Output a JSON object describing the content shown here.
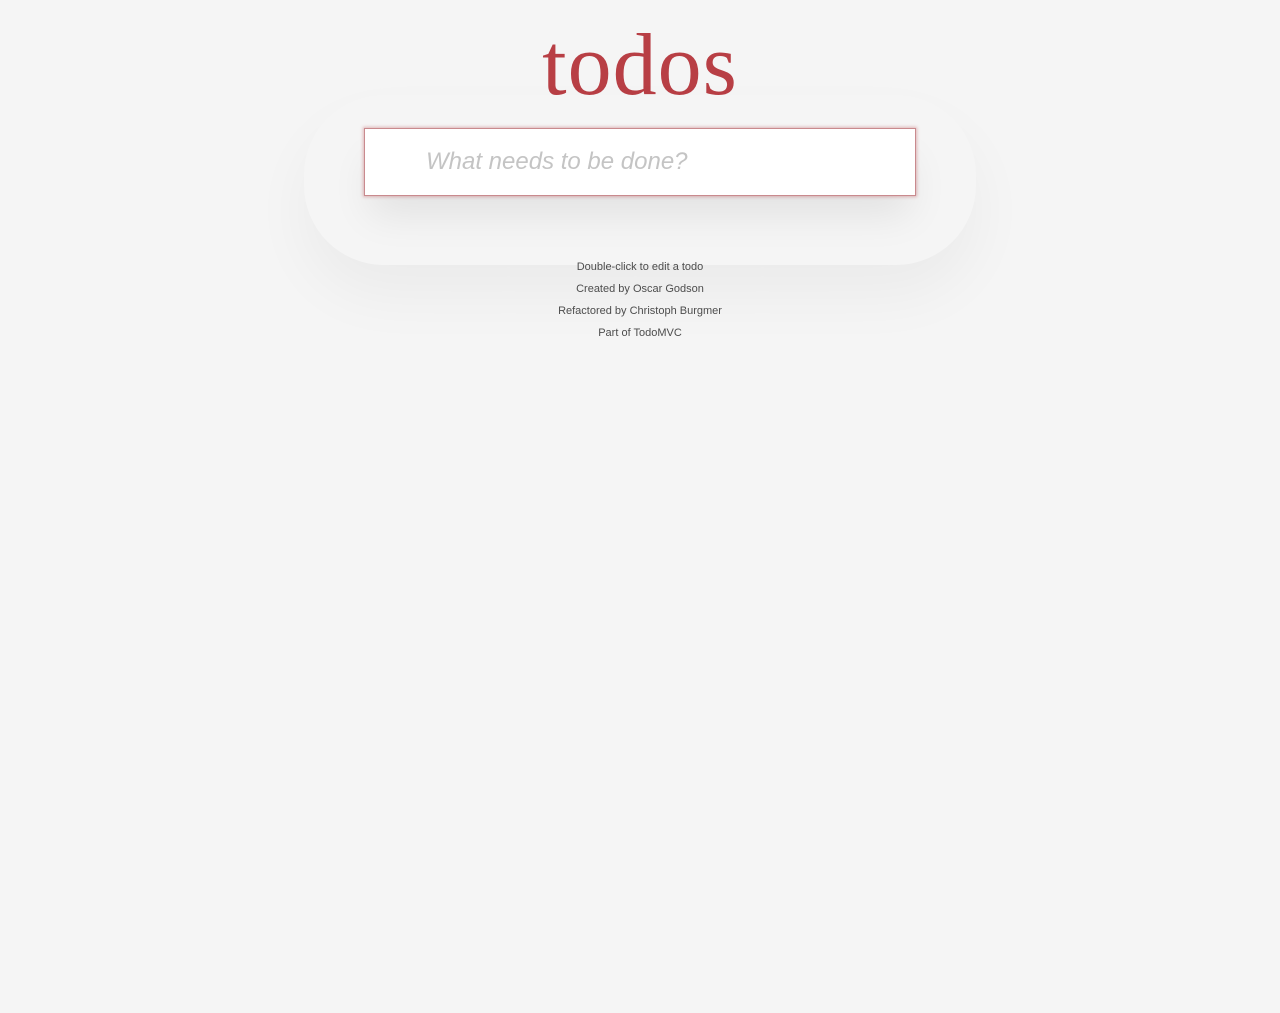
{
  "app": {
    "title": "todos"
  },
  "new_todo": {
    "value": "",
    "placeholder": "What needs to be done?"
  },
  "info": {
    "edit_hint": "Double-click to edit a todo",
    "created_by_prefix": "Created by ",
    "created_by_name": "Oscar Godson",
    "refactored_by_prefix": "Refactored by ",
    "refactored_by_name": "Christoph Burgmer",
    "part_of_prefix": "Part of ",
    "part_of_name": "TodoMVC"
  },
  "colors": {
    "brand_accent": "#b83f45",
    "background": "#f5f5f5",
    "text": "#4d4d4d",
    "placeholder": "#c4c4c4"
  }
}
